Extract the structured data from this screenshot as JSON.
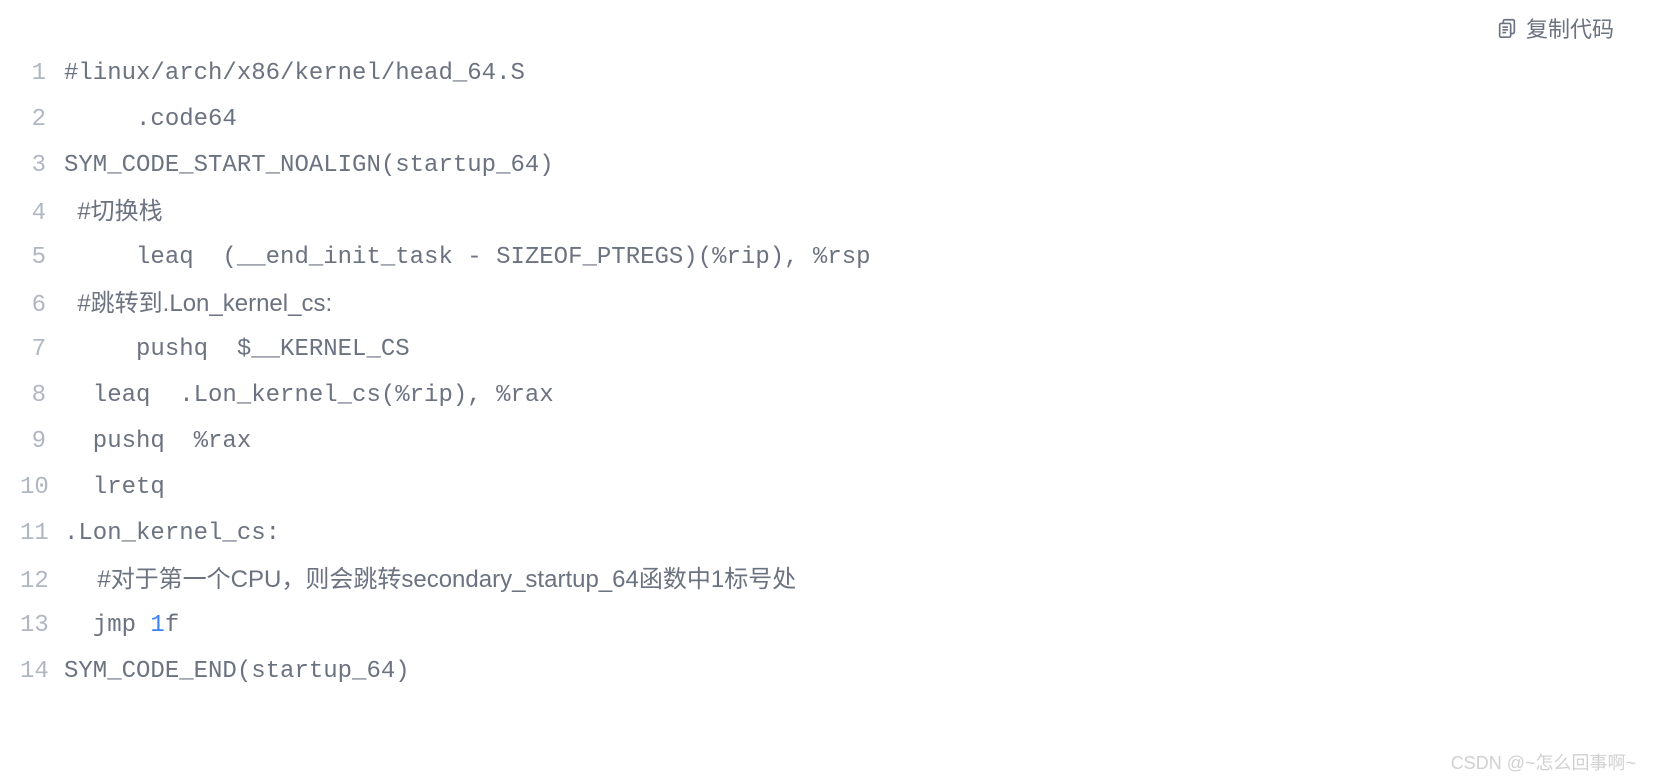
{
  "copyButton": {
    "label": "复制代码"
  },
  "code": {
    "lines": [
      {
        "n": "1",
        "text": "#linux/arch/x86/kernel/head_64.S"
      },
      {
        "n": "2",
        "text": "     .code64"
      },
      {
        "n": "3",
        "text": "SYM_CODE_START_NOALIGN(startup_64)"
      },
      {
        "n": "4",
        "text": "  #切换栈"
      },
      {
        "n": "5",
        "text": "     leaq  (__end_init_task - SIZEOF_PTREGS)(%rip), %rsp"
      },
      {
        "n": "6",
        "text": "  #跳转到.Lon_kernel_cs:"
      },
      {
        "n": "7",
        "text": "     pushq  $__KERNEL_CS"
      },
      {
        "n": "8",
        "text": "  leaq  .Lon_kernel_cs(%rip), %rax"
      },
      {
        "n": "9",
        "text": "  pushq  %rax"
      },
      {
        "n": "10",
        "text": "  lretq"
      },
      {
        "n": "11",
        "text": ".Lon_kernel_cs:"
      },
      {
        "n": "12",
        "text": "     #对于第一个CPU，则会跳转secondary_startup_64函数中1标号处"
      },
      {
        "n": "13",
        "text_pre": "  jmp ",
        "num": "1",
        "text_post": "f"
      },
      {
        "n": "14",
        "text": "SYM_CODE_END(startup_64)"
      }
    ]
  },
  "watermark": "CSDN @~怎么回事啊~"
}
